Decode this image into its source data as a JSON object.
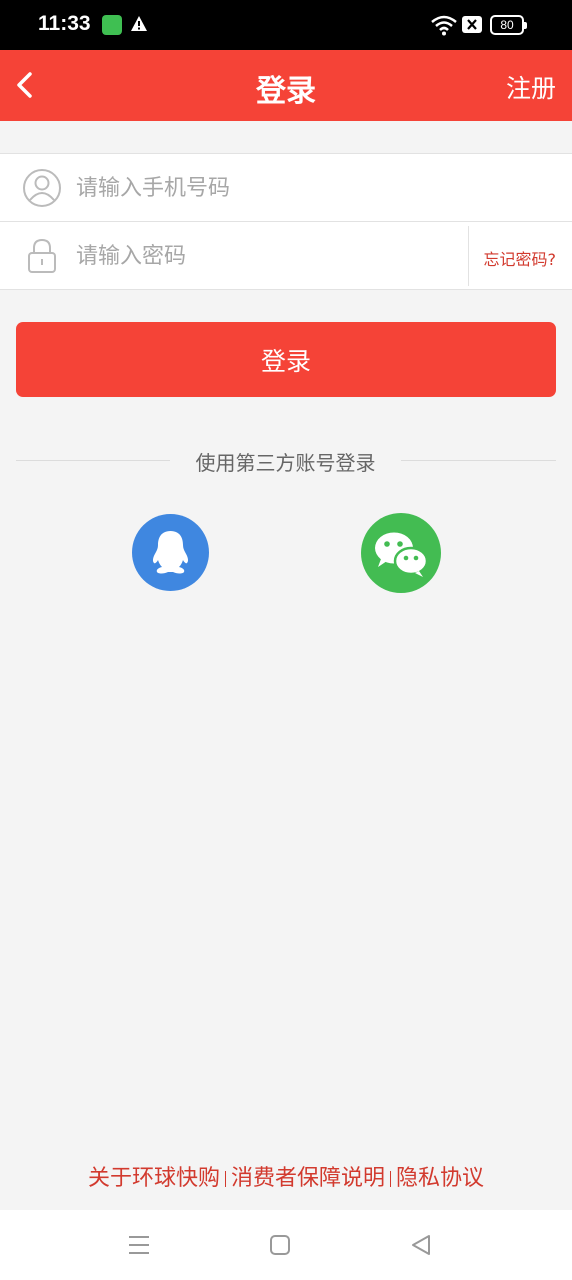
{
  "status_bar": {
    "time": "11:33",
    "battery": "80"
  },
  "header": {
    "title": "登录",
    "register_label": "注册"
  },
  "form": {
    "phone_placeholder": "请输入手机号码",
    "password_placeholder": "请输入密码",
    "forgot_label": "忘记密码?"
  },
  "login_button": "登录",
  "third_party": {
    "label": "使用第三方账号登录",
    "providers": [
      "qq-icon",
      "wechat-icon"
    ]
  },
  "footer": {
    "links": [
      "关于环球快购",
      "消费者保障说明",
      "隐私协议"
    ]
  },
  "colors": {
    "primary": "#f54337",
    "link": "#d23a2e",
    "qq": "#3f87e0",
    "wechat": "#43bc52",
    "background": "#f4f4f4"
  }
}
